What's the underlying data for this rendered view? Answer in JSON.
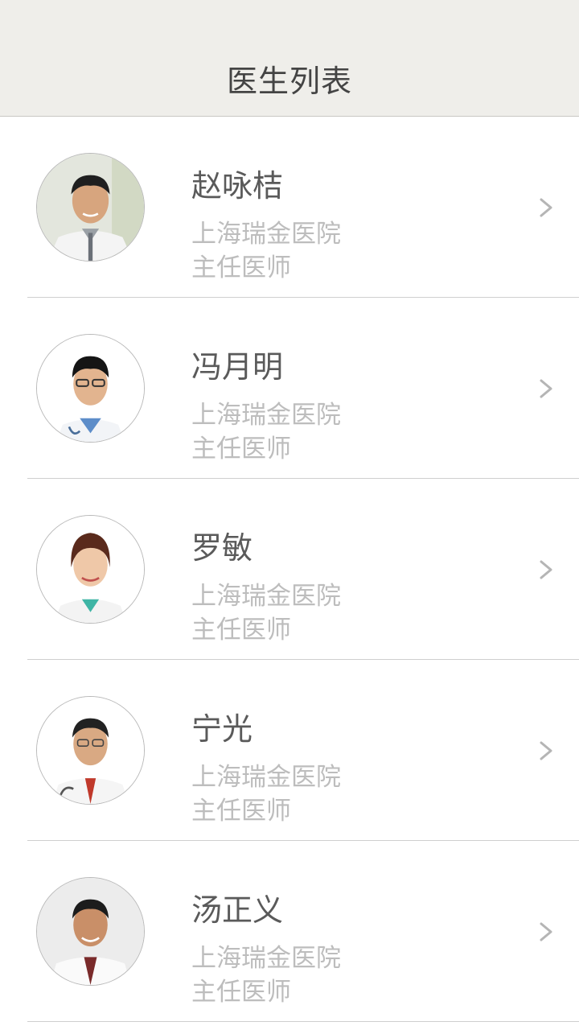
{
  "header": {
    "title": "医生列表"
  },
  "doctors": [
    {
      "name": "赵咏桔",
      "hospital": "上海瑞金医院",
      "title": "主任医师",
      "avatar_icon": "doctor-photo"
    },
    {
      "name": "冯月明",
      "hospital": "上海瑞金医院",
      "title": "主任医师",
      "avatar_icon": "doctor-photo"
    },
    {
      "name": "罗敏",
      "hospital": "上海瑞金医院",
      "title": "主任医师",
      "avatar_icon": "doctor-photo"
    },
    {
      "name": "宁光",
      "hospital": "上海瑞金医院",
      "title": "主任医师",
      "avatar_icon": "doctor-photo"
    },
    {
      "name": "汤正义",
      "hospital": "上海瑞金医院",
      "title": "主任医师",
      "avatar_icon": "doctor-photo"
    }
  ],
  "colors": {
    "header_bg": "#efeeea",
    "name_text": "#5a5a5a",
    "meta_text": "#bdbdbd",
    "chevron": "#b5b5b5"
  }
}
